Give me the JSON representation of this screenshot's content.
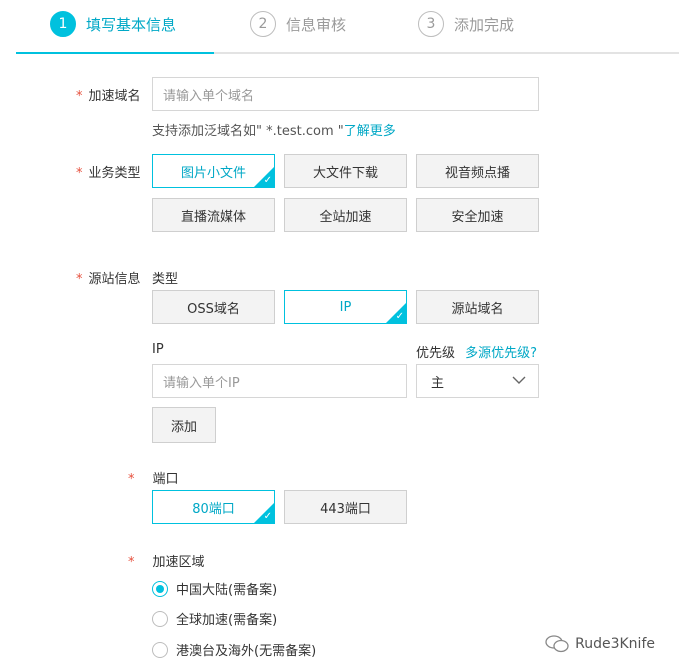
{
  "steps": [
    {
      "num": "1",
      "label": "填写基本信息"
    },
    {
      "num": "2",
      "label": "信息审核"
    },
    {
      "num": "3",
      "label": "添加完成"
    }
  ],
  "domain": {
    "label": "加速域名",
    "placeholder": "请输入单个域名",
    "hint_prefix": "支持添加泛域名如\" *.test.com \"",
    "hint_link": "了解更多"
  },
  "business": {
    "label": "业务类型",
    "options": [
      "图片小文件",
      "大文件下载",
      "视音频点播",
      "直播流媒体",
      "全站加速",
      "安全加速"
    ],
    "selected": "图片小文件"
  },
  "origin": {
    "label": "源站信息",
    "type_label": "类型",
    "types": [
      "OSS域名",
      "IP",
      "源站域名"
    ],
    "selected_type": "IP",
    "ip_label": "IP",
    "ip_placeholder": "请输入单个IP",
    "priority_label": "优先级",
    "priority_link": "多源优先级?",
    "priority_value": "主",
    "add_button": "添加"
  },
  "port": {
    "label": "端口",
    "options": [
      "80端口",
      "443端口"
    ],
    "selected": "80端口"
  },
  "region": {
    "label": "加速区域",
    "options": [
      "中国大陆(需备案)",
      "全球加速(需备案)",
      "港澳台及海外(无需备案)"
    ],
    "selected": "中国大陆(需备案)"
  },
  "required_mark": "*",
  "watermark": "Rude3Knife",
  "colors": {
    "accent": "#00c1de",
    "required": "#e64f3c"
  }
}
